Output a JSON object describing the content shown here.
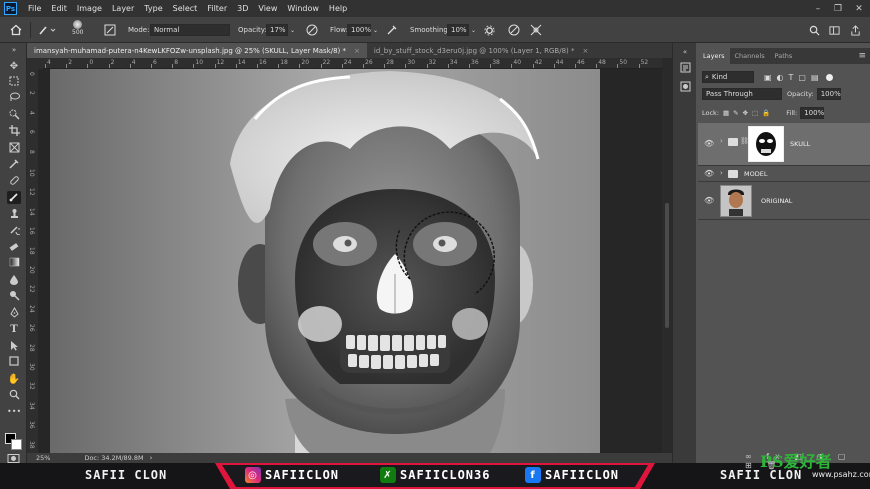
{
  "app": {
    "logo_text": "Ps"
  },
  "menu": [
    "File",
    "Edit",
    "Image",
    "Layer",
    "Type",
    "Select",
    "Filter",
    "3D",
    "View",
    "Window",
    "Help"
  ],
  "window_controls": {
    "minimize": "–",
    "restore": "❐",
    "close": "✕"
  },
  "options_bar": {
    "brush_size": "500",
    "mode_label": "Mode:",
    "mode_value": "Normal",
    "opacity_label": "Opacity:",
    "opacity_value": "17%",
    "flow_label": "Flow:",
    "flow_value": "100%",
    "smoothing_label": "Smoothing:",
    "smoothing_value": "10%"
  },
  "tabs": [
    {
      "label": "imansyah-muhamad-putera-n4KewLKFOZw-unsplash.jpg @ 25% (SKULL, Layer Mask/8) *",
      "close": "×"
    },
    {
      "label": "id_by_stuff_stock_d3eru0j.jpg @ 100% (Layer 1, RGB/8) *",
      "close": "×"
    }
  ],
  "ruler": {
    "h_labels": [
      "4",
      "2",
      "0",
      "2",
      "4",
      "6",
      "8",
      "10",
      "12",
      "14",
      "16",
      "18",
      "20",
      "22",
      "24",
      "26",
      "28",
      "30",
      "32",
      "34",
      "36",
      "38",
      "40",
      "42",
      "44",
      "46",
      "48",
      "50",
      "52"
    ],
    "v_labels": [
      "0",
      "2",
      "4",
      "6",
      "8",
      "10",
      "12",
      "14",
      "16",
      "18",
      "20",
      "22",
      "24",
      "26",
      "28",
      "30",
      "32",
      "34",
      "36",
      "38"
    ]
  },
  "status": {
    "zoom": "25%",
    "doc": "Doc: 34.2M/89.8M"
  },
  "layers_panel": {
    "tabs": [
      "Layers",
      "Channels",
      "Paths"
    ],
    "filter_kind": "Kind",
    "blend_mode": "Pass Through",
    "opacity_label": "Opacity:",
    "opacity_value": "100%",
    "lock_label": "Lock:",
    "fill_label": "Fill:",
    "fill_value": "100%",
    "layers": [
      {
        "name": "SKULL"
      },
      {
        "name": "MODEL"
      },
      {
        "name": "ORIGINAL"
      }
    ]
  },
  "banner": {
    "left_name": "SAFII CLON",
    "instagram": "SAFIICLON",
    "xbox": "SAFIICLON36",
    "facebook": "SAFIICLON",
    "right_name": "SAFII CLON"
  },
  "watermark": {
    "text": "PS爱好者",
    "sub": "www.psahz.com"
  },
  "colors": {
    "accent": "#31a8ff",
    "banner_red": "#e0153c",
    "instagram": "#c13584",
    "xbox": "#107c10",
    "facebook": "#1877f2"
  }
}
